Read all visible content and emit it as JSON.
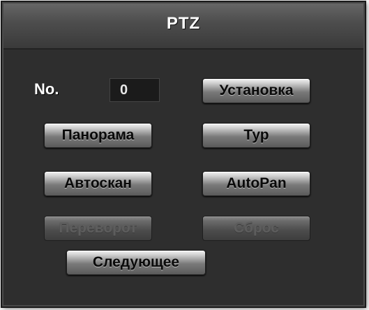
{
  "dialog": {
    "title": "PTZ"
  },
  "fields": {
    "no_label": "No.",
    "no_value": "0"
  },
  "buttons": {
    "setup": "Установка",
    "panorama": "Панорама",
    "tour": "Тур",
    "autoscan": "Автоскан",
    "autopan": "AutoPan",
    "flip": "Переворот",
    "reset": "Сброс",
    "next": "Следующее"
  },
  "colors": {
    "background": "#2e2e2e",
    "titlebar": "#4e4e4e",
    "button_face": "#7a7a7a",
    "text": "#ffffff"
  }
}
